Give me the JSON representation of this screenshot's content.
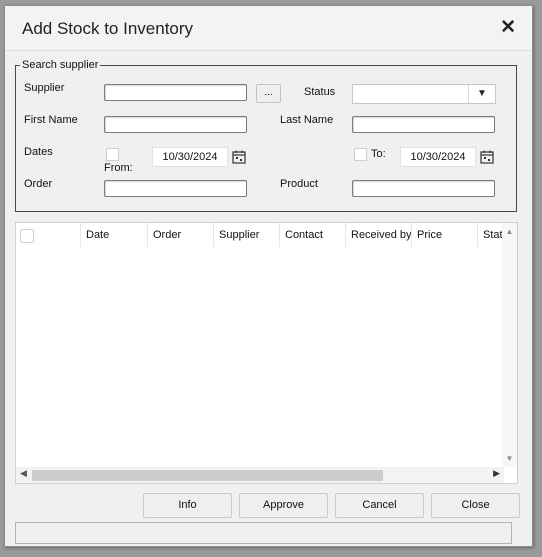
{
  "window": {
    "title": "Add Stock to Inventory",
    "close_glyph": "✕"
  },
  "search": {
    "legend": "Search supplier",
    "supplier_label": "Supplier",
    "supplier_value": "",
    "browse_label": "...",
    "status_label": "Status",
    "status_value": "",
    "first_name_label": "First Name",
    "first_name_value": "",
    "last_name_label": "Last Name",
    "last_name_value": "",
    "dates_label": "Dates",
    "from_label": "From:",
    "from_date": "10/30/2024",
    "to_label": "To:",
    "to_date": "10/30/2024",
    "order_label": "Order",
    "order_value": "",
    "product_label": "Product",
    "product_value": ""
  },
  "grid": {
    "columns": [
      "Date",
      "Order",
      "Supplier",
      "Contact",
      "Received by",
      "Price",
      "Stat"
    ],
    "rows": []
  },
  "footer": {
    "info_label": "Info",
    "approve_label": "Approve",
    "cancel_label": "Cancel",
    "close_label": "Close"
  },
  "icons": {
    "dropdown": "chevron-down-icon",
    "calendar": "calendar-icon",
    "scroll_up": "scroll-up-icon",
    "scroll_down": "scroll-down-icon",
    "scroll_left": "scroll-left-icon",
    "scroll_right": "scroll-right-icon"
  }
}
